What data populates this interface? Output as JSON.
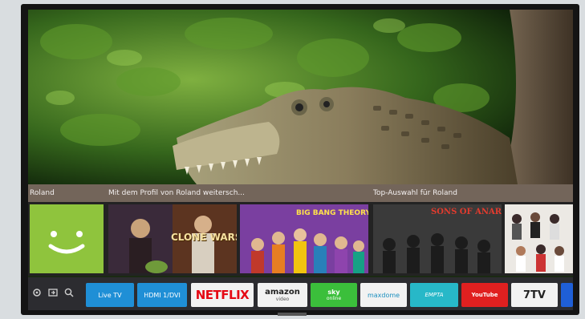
{
  "sections": {
    "user_label": "Roland",
    "continue_label": "Mit dem Profil von Roland weitersch...",
    "top_picks_label": "Top-Auswahl für Roland"
  },
  "tiles": {
    "clone_wars_title": "CLONE WARS",
    "bigbang_title": "BIG BANG THEORY",
    "sons_title": "SONS OF ANARCHY"
  },
  "apps": [
    {
      "label": "Live TV",
      "bg": "#1f8fd6"
    },
    {
      "label": "HDMI 1/DVI",
      "bg": "#1f8fd6"
    },
    {
      "label": "NETFLIX",
      "bg": "#f2f2f2",
      "fg": "#e50914"
    },
    {
      "label": "amazon",
      "sub": "video",
      "bg": "#f2f2f2",
      "fg": "#222"
    },
    {
      "label": "sky",
      "sub": "online",
      "bg": "#3bbf3b"
    },
    {
      "label": "maxdome",
      "bg": "#f2f2f2",
      "fg": "#1b8fbf"
    },
    {
      "label": "EMPTA",
      "bg": "#27b8c8"
    },
    {
      "label": "YouTube",
      "bg": "#e02020"
    },
    {
      "label": "7TV",
      "bg": "#f2f2f2",
      "fg": "#222"
    }
  ],
  "colors": {
    "android_green": "#8fc43d",
    "dock_bg": "#2c2c30",
    "section_bar": "#be9696"
  },
  "icons": [
    "settings-icon",
    "source-icon",
    "search-icon"
  ]
}
